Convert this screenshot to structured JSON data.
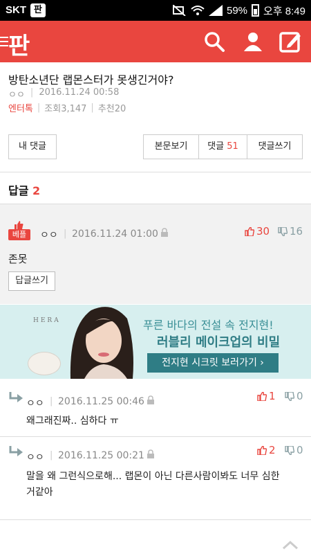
{
  "status_bar": {
    "carrier": "SKT",
    "app_badge": "판",
    "battery": "59%",
    "time": "오후 8:49"
  },
  "app_bar": {
    "logo": "판",
    "brand_color": "#e9463f"
  },
  "post": {
    "title": "방탄소년단 랩몬스터가 못생긴거야?",
    "author": "ㅇㅇ",
    "date": "2016.11.24 00:58",
    "category": "엔터톡",
    "views": "조회3,147",
    "recommends": "추천20"
  },
  "toolbar": {
    "my_comments": "내 댓글",
    "view_post": "본문보기",
    "comments_label": "댓글",
    "comments_count": "51",
    "write_comment": "댓글쓰기"
  },
  "replies_header": {
    "label": "답글",
    "count": "2"
  },
  "best_reply": {
    "badge": "베플",
    "author": "ㅇㅇ",
    "date": "2016.11.24 01:00",
    "upvotes": "30",
    "downvotes": "16",
    "content": "존못",
    "reply_button": "답글쓰기"
  },
  "ad": {
    "brand": "HERA",
    "line1": "푸른 바다의 전설 속 전지현!",
    "line2": "러블리 메이크업의 비밀",
    "cta": "전지현 시크릿 보러가기 ›"
  },
  "replies": [
    {
      "author": "ㅇㅇ",
      "date": "2016.11.25 00:46",
      "upvotes": "1",
      "downvotes": "0",
      "text": "왜그래진짜.. 심하다 ㅠ"
    },
    {
      "author": "ㅇㅇ",
      "date": "2016.11.25 00:21",
      "upvotes": "2",
      "downvotes": "0",
      "text_line1": "말을 왜 그런식으로해... 랩몬이 아닌 다른사람이봐도 너무 심한",
      "text_line2": "거같아"
    }
  ]
}
